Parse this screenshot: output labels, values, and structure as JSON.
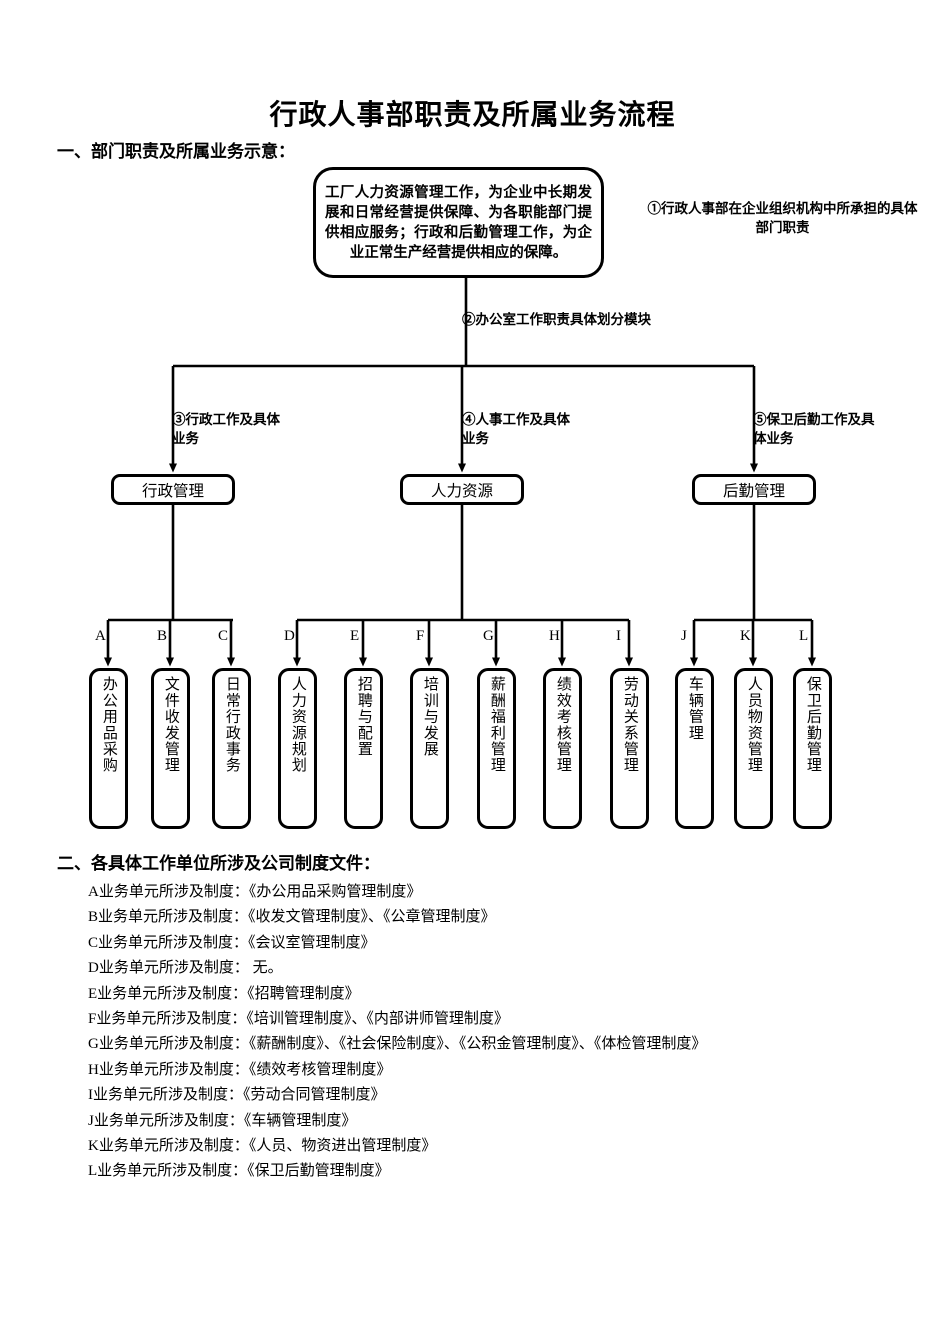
{
  "document": {
    "title": "行政人事部职责及所属业务流程"
  },
  "sections": {
    "one_heading": "一、部门职责及所属业务示意：",
    "two_heading": "二、各具体工作单位所涉及公司制度文件："
  },
  "flowchart": {
    "top_box": "工厂人力资源管理工作，为企业中长期发展和日常经营提供保障、为各职能部门提供相应服务；行政和后勤管理工作，为企业正常生产经营提供相应的保障。",
    "notes": [
      {
        "id": "note-1",
        "text": "①行政人事部在企业组织机构中所承担的具体部门职责"
      },
      {
        "id": "note-2",
        "text": "②办公室工作职责具体划分模块"
      },
      {
        "id": "note-3",
        "text": "③行政工作及具体业务"
      },
      {
        "id": "note-4",
        "text": "④人事工作及具体业务"
      },
      {
        "id": "note-5",
        "text": "⑤保卫后勤工作及具体业务"
      }
    ],
    "level2": [
      {
        "label": "行政管理"
      },
      {
        "label": "人力资源"
      },
      {
        "label": "后勤管理"
      }
    ],
    "leaves": [
      {
        "letter": "A",
        "label": "办公用品采购"
      },
      {
        "letter": "B",
        "label": "文件收发管理"
      },
      {
        "letter": "C",
        "label": "日常行政事务"
      },
      {
        "letter": "D",
        "label": "人力资源规划"
      },
      {
        "letter": "E",
        "label": "招聘与配置"
      },
      {
        "letter": "F",
        "label": "培训与发展"
      },
      {
        "letter": "G",
        "label": "薪酬福利管理"
      },
      {
        "letter": "H",
        "label": "绩效考核管理"
      },
      {
        "letter": "I",
        "label": "劳动关系管理"
      },
      {
        "letter": "J",
        "label": "车辆管理"
      },
      {
        "letter": "K",
        "label": "人员物资管理"
      },
      {
        "letter": "L",
        "label": "保卫后勤管理"
      }
    ]
  },
  "policies": [
    {
      "line": "A业务单元所涉及制度：《办公用品采购管理制度》"
    },
    {
      "line": "B业务单元所涉及制度：《收发文管理制度》、《公章管理制度》"
    },
    {
      "line": "C业务单元所涉及制度：《会议室管理制度》"
    },
    {
      "line": "D业务单元所涉及制度： 无。"
    },
    {
      "line": "E业务单元所涉及制度：《招聘管理制度》"
    },
    {
      "line": "F业务单元所涉及制度：《培训管理制度》、《内部讲师管理制度》"
    },
    {
      "line": "G业务单元所涉及制度：《薪酬制度》、《社会保险制度》、《公积金管理制度》、《体检管理制度》"
    },
    {
      "line": "H业务单元所涉及制度：《绩效考核管理制度》"
    },
    {
      "line": "I业务单元所涉及制度：《劳动合同管理制度》"
    },
    {
      "line": "J业务单元所涉及制度：《车辆管理制度》"
    },
    {
      "line": "K业务单元所涉及制度：《人员、物资进出管理制度》"
    },
    {
      "line": "L业务单元所涉及制度：《保卫后勤管理制度》"
    }
  ]
}
